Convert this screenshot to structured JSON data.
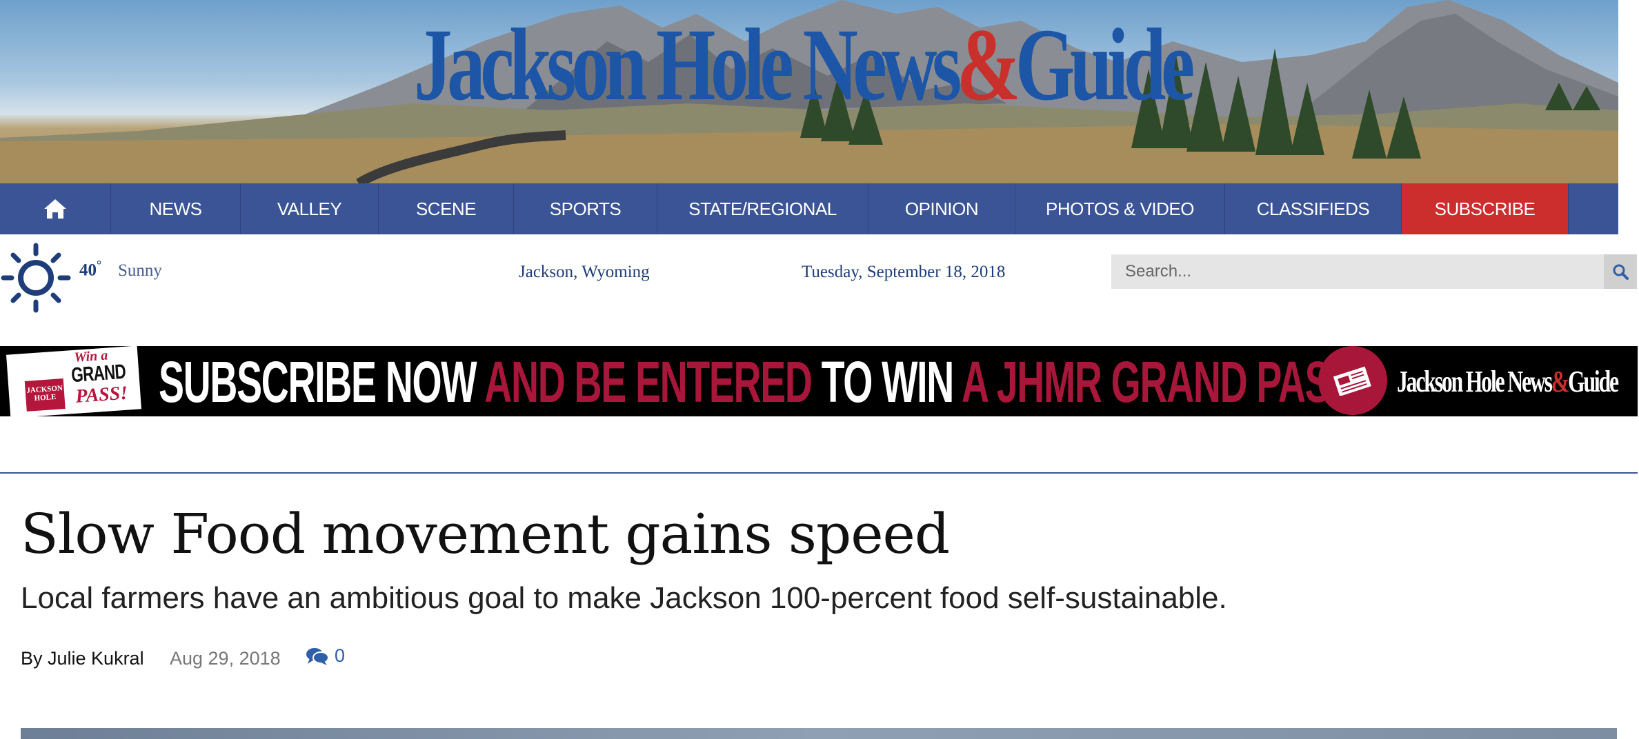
{
  "masthead": {
    "title_part1": "Jackson Hole News",
    "title_amp": "&",
    "title_part2": "Guide"
  },
  "nav": {
    "items": [
      {
        "label": "NEWS"
      },
      {
        "label": "VALLEY"
      },
      {
        "label": "SCENE"
      },
      {
        "label": "SPORTS"
      },
      {
        "label": "STATE/REGIONAL"
      },
      {
        "label": "OPINION"
      },
      {
        "label": "PHOTOS & VIDEO"
      },
      {
        "label": "CLASSIFIEDS"
      },
      {
        "label": "SUBSCRIBE"
      }
    ],
    "home_icon": "home-icon",
    "bar_color": "#3a5496",
    "subscribe_color": "#cc2d2d"
  },
  "weather": {
    "temp": "40",
    "degree": "°",
    "condition": "Sunny",
    "icon": "sun-icon"
  },
  "location": "Jackson, Wyoming",
  "date": "Tuesday, September 18, 2018",
  "search": {
    "placeholder": "Search...",
    "icon": "search-icon"
  },
  "banner": {
    "badge_win": "Win a",
    "badge_grand": "GRAND",
    "badge_pass": "PASS!",
    "badge_logo": "JACKSON HOLE",
    "text_1": "SUBSCRIBE NOW ",
    "text_2": "AND BE ENTERED ",
    "text_3": "TO WIN ",
    "text_4": "A JHMR GRAND PASS",
    "brand_part1": "Jackson Hole News",
    "brand_amp": "&",
    "brand_part2": "Guide",
    "accent_color": "#a8173a"
  },
  "article": {
    "headline": "Slow Food movement gains speed",
    "subhead": "Local farmers have an ambitious goal to make Jackson 100-percent food self-sustainable.",
    "byline": "By Julie Kukral",
    "date": "Aug 29, 2018",
    "comment_count": "0",
    "comment_icon": "comments-icon"
  }
}
